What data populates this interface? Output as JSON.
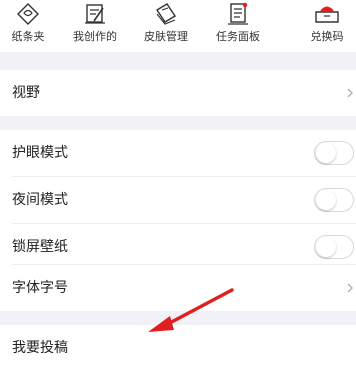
{
  "toolbar": {
    "items": [
      {
        "label": "纸条夹",
        "icon": "note-clip-icon"
      },
      {
        "label": "我创作的",
        "icon": "edit-doc-icon"
      },
      {
        "label": "皮肤管理",
        "icon": "skin-cards-icon"
      },
      {
        "label": "任务面板",
        "icon": "task-board-icon"
      },
      {
        "label": "兑换码",
        "icon": "exchange-ticket-icon"
      }
    ]
  },
  "settings": {
    "view": {
      "label": "视野"
    },
    "eye_mode": {
      "label": "护眼模式",
      "enabled": false
    },
    "night_mode": {
      "label": "夜间模式",
      "enabled": false
    },
    "lock_wallpaper": {
      "label": "锁屏壁纸",
      "enabled": false
    },
    "font_size": {
      "label": "字体字号"
    },
    "contribute": {
      "label": "我要投稿"
    }
  },
  "colors": {
    "section_gap": "#f2f2f6",
    "annotation_arrow": "#e02020",
    "icon_stroke": "#333333",
    "icon_accent": "#e02020"
  }
}
